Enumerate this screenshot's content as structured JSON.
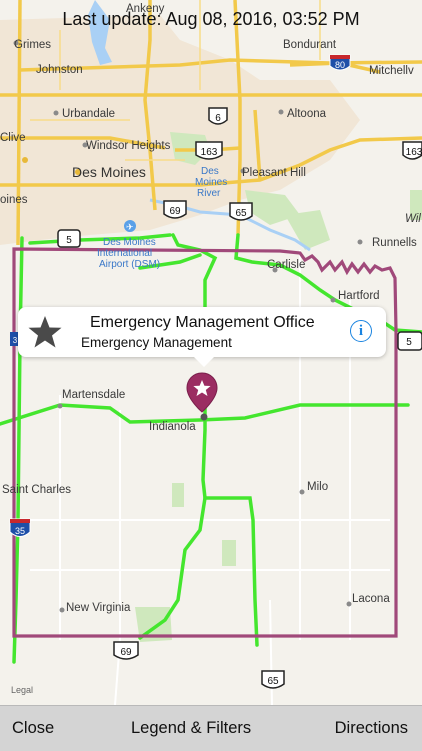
{
  "status": {
    "last_update": "Last update: Aug 08, 2016, 03:52 PM"
  },
  "map": {
    "towns": {
      "ankeny": "Ankeny",
      "grimes": "Grimes",
      "johnston": "Johnston",
      "bondurant": "Bondurant",
      "mitchellville": "Mitchellv",
      "urbandale": "Urbandale",
      "altoona": "Altoona",
      "clive": "Clive",
      "windsor_heights": "Windsor Heights",
      "des_moines": "Des Moines",
      "pleasant_hill": "Pleasant Hill",
      "west_des_moines": "oines",
      "runnells": "Runnells",
      "carlisle": "Carlisle",
      "hartford": "Hartford",
      "martensdale": "Martensdale",
      "indianola": "Indianola",
      "saint_charles": "Saint Charles",
      "milo": "Milo",
      "new_virginia": "New Virginia",
      "lacona": "Lacona",
      "wildlife": "Wil"
    },
    "airport": [
      "Des Moines",
      "International",
      "Airport (DSM)"
    ],
    "river": [
      "Des",
      "Moines",
      "River"
    ],
    "shields": {
      "i80": "80",
      "us6": "6",
      "us163a": "163",
      "us163b": "163",
      "us69a": "69",
      "us65a": "65",
      "us5a": "5",
      "us5b": "5",
      "i35": "35",
      "i35_left": "3",
      "us69b": "69",
      "us65b": "65"
    },
    "legal": "Legal",
    "colors": {
      "county_border": "#a0497a",
      "highway_status": "#44e62e",
      "major_roads": "#f2c94a",
      "pin": "#9b2d62"
    }
  },
  "callout": {
    "title": "Emergency Management Office",
    "subtitle": "Emergency Management",
    "icon": "star-icon",
    "info_icon": "i"
  },
  "toolbar": {
    "close": "Close",
    "legend": "Legend & Filters",
    "directions": "Directions"
  }
}
